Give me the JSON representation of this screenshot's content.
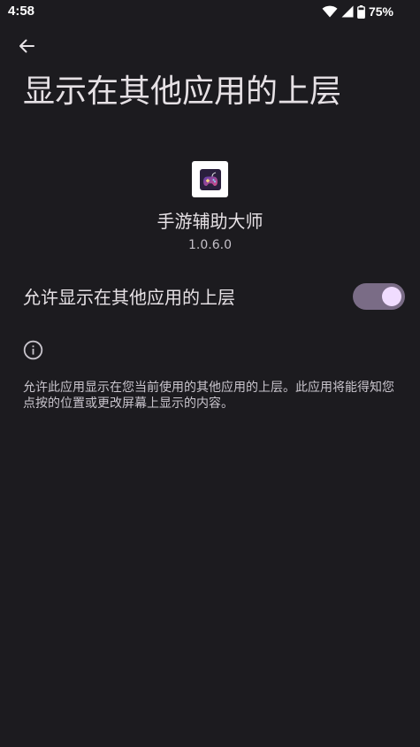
{
  "status_bar": {
    "time": "4:58",
    "battery_percent": "75%",
    "icons": [
      "wifi-icon",
      "signal-icon",
      "battery-icon"
    ]
  },
  "header": {
    "back_icon": "arrow-back-icon",
    "title": "显示在其他应用的上层"
  },
  "app": {
    "icon": "gamepad-app-icon",
    "name": "手游辅助大师",
    "version": "1.0.6.0"
  },
  "setting": {
    "label": "允许显示在其他应用的上层",
    "enabled": true
  },
  "info": {
    "icon": "info-icon",
    "text": "允许此应用显示在您当前使用的其他应用的上层。此应用将能得知您点按的位置或更改屏幕上显示的内容。"
  },
  "colors": {
    "background": "#1c1b1f",
    "switch_track": "#7a6c86",
    "switch_thumb": "#f0dcff",
    "text_primary": "#e6e1e5",
    "text_secondary": "#c9c5cd"
  }
}
